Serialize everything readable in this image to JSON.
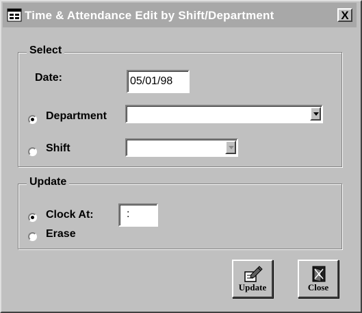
{
  "window": {
    "title": "Time & Attendance Edit by Shift/Department",
    "close_glyph": "X"
  },
  "select_group": {
    "label": "Select",
    "date_label": "Date:",
    "date_value": "05/01/98",
    "department_label": "Department",
    "department_value": "",
    "department_checked": true,
    "shift_label": "Shift",
    "shift_value": "",
    "shift_checked": false
  },
  "update_group": {
    "label": "Update",
    "clock_at_label": "Clock At:",
    "clock_at_value": ":",
    "clock_at_checked": true,
    "erase_label": "Erase",
    "erase_checked": false
  },
  "buttons": {
    "update_label": "Update",
    "close_label": "Close"
  },
  "icons": {
    "app": "app-window-icon",
    "update": "pencil-note-icon",
    "close": "door-close-icon"
  },
  "colors": {
    "window_bg": "#c0c0c0",
    "titlebar_bg": "#a8a8a8",
    "titlebar_text": "#ffffff"
  }
}
